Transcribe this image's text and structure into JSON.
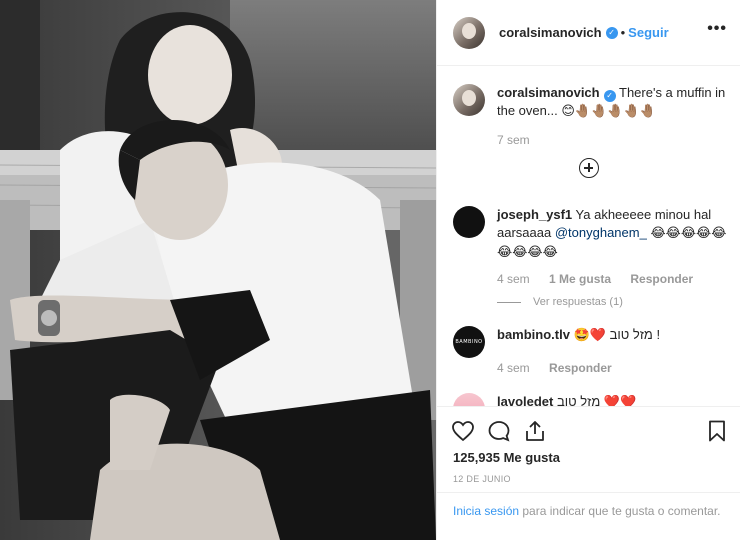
{
  "post": {
    "author": "coralsimanovich",
    "follow_label": "Seguir",
    "separator": "•",
    "more_label": "•••"
  },
  "caption": {
    "username": "coralsimanovich",
    "text": "There's a muffin in the oven...",
    "emojis": "😊🤚🏽🤚🏽🤚🏽🤚🏽🤚🏽",
    "time": "7 sem"
  },
  "comments": [
    {
      "username": "joseph_ysf1",
      "text": "Ya akheeeee minou hal aarsaaaa",
      "mention": "@tonyghanem_",
      "emojis": "😂😂😂😂😂😂😂😂😂",
      "time": "4 sem",
      "likes": "1 Me gusta",
      "reply_label": "Responder",
      "view_replies": "Ver respuestas (1)"
    },
    {
      "username": "bambino.tlv",
      "emojis_before": "🤩❤️",
      "text": "מזל טוב ! ",
      "time": "4 sem",
      "reply_label": "Responder",
      "avatar_text": "BAMBINO"
    },
    {
      "username": "lavoledet",
      "text": "מזל טוב",
      "emojis": "❤️❤️"
    }
  ],
  "actions": {
    "icons": [
      "heart-icon",
      "comment-icon",
      "share-icon",
      "bookmark-icon"
    ]
  },
  "likes": "125,935 Me gusta",
  "date": "12 DE JUNIO",
  "login": {
    "link": "Inicia sesión",
    "rest": " para indicar que te gusta o comentar."
  }
}
